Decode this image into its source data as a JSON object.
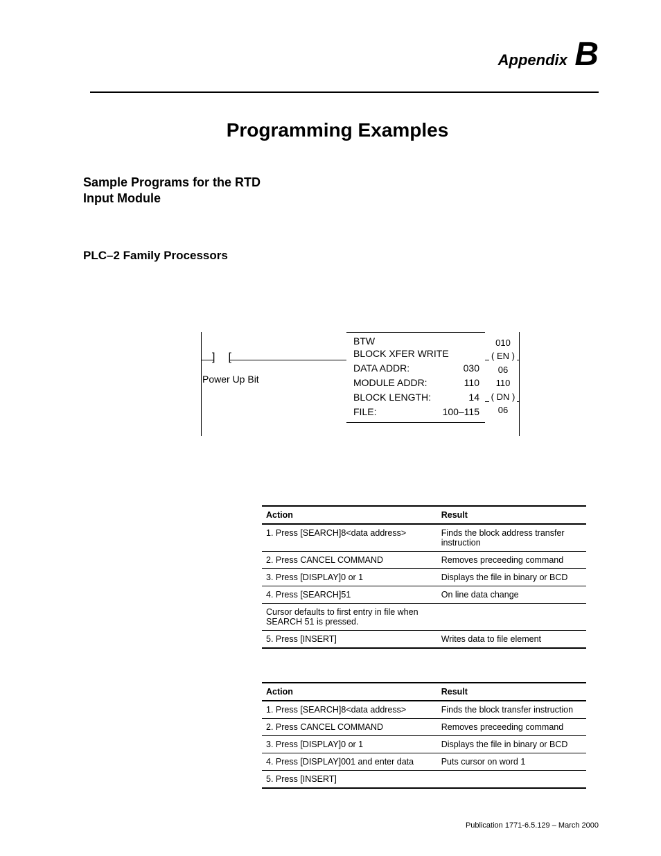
{
  "header": {
    "appendix_word": "Appendix",
    "appendix_letter": "B",
    "title": "Programming Examples"
  },
  "sections": {
    "sample": "Sample Programs for the RTD Input Module",
    "plc2": "PLC–2 Family Processors"
  },
  "ladder": {
    "power_up": "Power Up Bit",
    "inst_name": "BTW",
    "inst_title": "BLOCK XFER WRITE",
    "rows": [
      {
        "k": "DATA ADDR:",
        "v": "030"
      },
      {
        "k": "MODULE ADDR:",
        "v": "110"
      },
      {
        "k": "BLOCK LENGTH:",
        "v": "14"
      },
      {
        "k": "FILE:",
        "v": "100–115"
      }
    ],
    "out": {
      "r0": "010",
      "en": "( EN )",
      "r1": "06",
      "r2": "110",
      "dn": "( DN )",
      "r3": "06"
    }
  },
  "table1": {
    "h_action": "Action",
    "h_result": "Result",
    "rows": [
      {
        "a": "1. Press [SEARCH]8<data address>",
        "r": "Finds the block  address transfer instruction"
      },
      {
        "a": "2. Press CANCEL COMMAND",
        "r": "Removes preceeding command"
      },
      {
        "a": "3. Press [DISPLAY]0 or 1",
        "r": "Displays the file in binary or BCD"
      },
      {
        "a": "4. Press [SEARCH]51",
        "r": "On line data change"
      },
      {
        "a": "Cursor defaults to first entry in file when SEARCH 51 is pressed.",
        "r": ""
      },
      {
        "a": "5. Press [INSERT]",
        "r": "Writes data to file element"
      }
    ]
  },
  "table2": {
    "h_action": "Action",
    "h_result": "Result",
    "rows": [
      {
        "a": "1. Press [SEARCH]8<data  address>",
        "r": "Finds the block transfer instruction"
      },
      {
        "a": "2. Press CANCEL COMMAND",
        "r": "Removes preceeding command"
      },
      {
        "a": "3. Press [DISPLAY]0 or 1",
        "r": "Displays the file in binary or BCD"
      },
      {
        "a": "4. Press [DISPLAY]001 and enter data",
        "r": "Puts cursor on word 1"
      },
      {
        "a": "5. Press [INSERT]",
        "r": ""
      }
    ]
  },
  "footer": "Publication 1771-6.5.129 – March 2000"
}
